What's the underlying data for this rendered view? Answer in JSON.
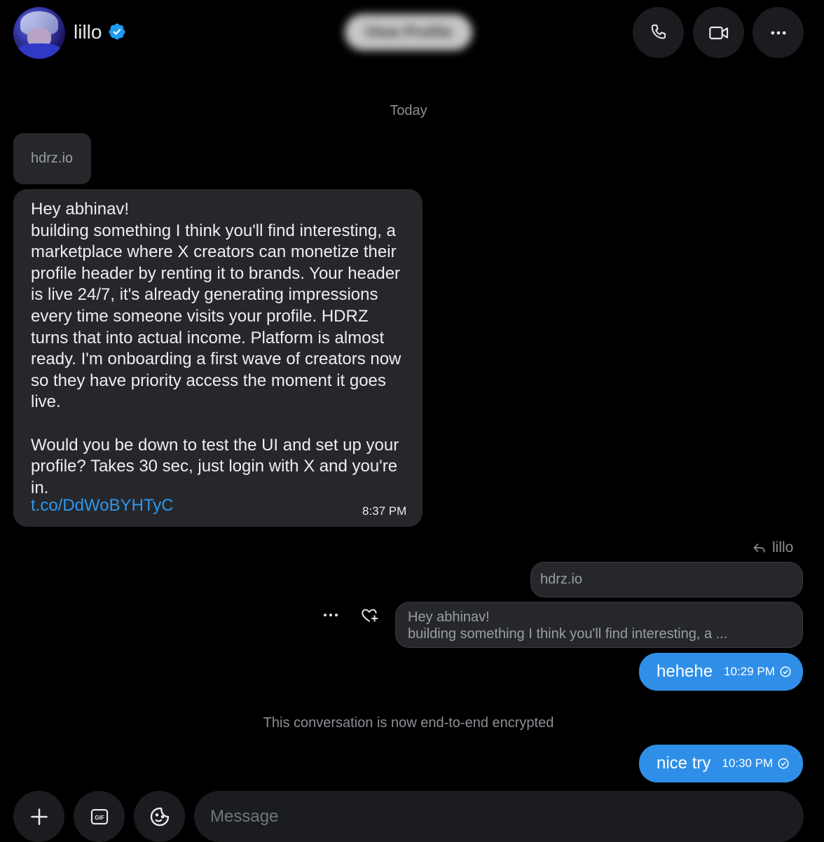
{
  "header": {
    "username": "lillo",
    "view_profile_label": "View Profile"
  },
  "date_separator": "Today",
  "incoming": {
    "link_preview": "hdrz.io",
    "text": "Hey abhinav!\nbuilding something I think you'll find interesting, a marketplace where X creators can monetize their profile header by renting it to brands. Your header is live 24/7, it's already generating impressions every time someone visits your profile. HDRZ turns that into actual income. Platform is almost ready. I'm onboarding a first wave of creators now so they have priority access the moment it goes live.\n\nWould you be down to test the UI and set up your profile? Takes 30 sec, just login with X and you're in.",
    "link": "t.co/DdWoBYHTyC",
    "time": "8:37 PM"
  },
  "reply": {
    "reply_to_name": "lillo",
    "preview": "hdrz.io",
    "quote_line1": "Hey abhinav!",
    "quote_line2": "building something I think you'll find interesting, a ..."
  },
  "outgoing": [
    {
      "text": "hehehe",
      "time": "10:29 PM"
    },
    {
      "text": "nice try",
      "time": "10:30 PM"
    }
  ],
  "encrypted_notice": "This conversation is now end-to-end encrypted",
  "composer": {
    "placeholder": "Message",
    "gif_label": "GIF"
  },
  "colors": {
    "accent_blue": "#2f8fe8",
    "bubble_gray": "#26272a",
    "verified_blue": "#1d9bf0"
  },
  "icons": [
    "verified-badge-icon",
    "phone-icon",
    "video-icon",
    "more-icon",
    "reply-arrow-icon",
    "react-heart-plus-icon",
    "sent-check-icon",
    "plus-icon",
    "gif-icon",
    "sticker-icon"
  ]
}
